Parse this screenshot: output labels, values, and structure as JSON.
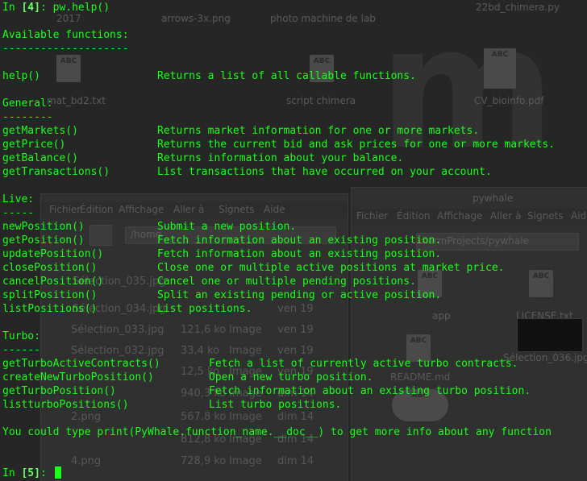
{
  "desktop": {
    "top_labels": [
      "2017",
      "arrows-3x.png",
      "photo machine de lab",
      "22bd_chimera.py"
    ],
    "mid_labels": [
      "mat_bd2.txt",
      "script chimera",
      "CV_bioinfo.pdf"
    ],
    "file_manager_left": {
      "menu": [
        "Fichier",
        "Édition",
        "Affichage",
        "Aller à",
        "Signets",
        "Aide"
      ],
      "path": "/home",
      "items": [
        {
          "name": "Sélection_035.jpg",
          "size": "",
          "type": "",
          "date": ""
        },
        {
          "name": "Sélection_034.jpg",
          "size": "",
          "type": "",
          "date": "ven 19"
        },
        {
          "name": "Sélection_033.jpg",
          "size": "121,6 ko",
          "type": "Image",
          "date": "ven 19"
        },
        {
          "name": "Sélection_032.jpg",
          "size": "33,4 ko",
          "type": "Image",
          "date": "ven 19"
        },
        {
          "name": "",
          "size": "12,5 ko",
          "type": "Image",
          "date": "ven 19"
        },
        {
          "name": "",
          "size": "940,3 ko",
          "type": "Image",
          "date": "dim 14"
        },
        {
          "name": "2.png",
          "size": "567,8 ko",
          "type": "Image",
          "date": "dim 14"
        },
        {
          "name": "",
          "size": "812,8 ko",
          "type": "Image",
          "date": "dim 14"
        },
        {
          "name": "4.png",
          "size": "728,9 ko",
          "type": "Image",
          "date": "dim 14"
        }
      ]
    },
    "file_manager_right": {
      "title": "pywhale",
      "menu": [
        "Fichier",
        "Édition",
        "Affichage",
        "Aller à",
        "Signets",
        "Aide"
      ],
      "path": "harmProjects/pywhale",
      "icons": [
        "app",
        "LICENSE.txt",
        "README.md",
        "Sélection_036.jpg"
      ]
    }
  },
  "terminal": {
    "prompt_in": "In",
    "prompt_num_1": "[4]",
    "command": "pw.help()",
    "header": "Available functions:",
    "rule_main": "--------------------",
    "help_fn": "help()",
    "help_desc": "Returns a list of all callable functions.",
    "sections": [
      {
        "title": "General:",
        "rule": "--------",
        "indent": 192,
        "items": [
          {
            "fn": "getMarkets()",
            "desc": "Returns market information for one or more markets."
          },
          {
            "fn": "getPrice()",
            "desc": "Returns the current bid and ask prices for one or more markets."
          },
          {
            "fn": "getBalance()",
            "desc": "Returns information about your balance."
          },
          {
            "fn": "getTransactions()",
            "desc": "List transactions that have occurred on your account."
          }
        ]
      },
      {
        "title": "Live:",
        "rule": "-----",
        "indent": 192,
        "items": [
          {
            "fn": "newPosition()",
            "desc": "Submit a new position."
          },
          {
            "fn": "getPosition()",
            "desc": "Fetch information about an existing position."
          },
          {
            "fn": "updatePosition()",
            "desc": "Fetch information about an existing position."
          },
          {
            "fn": "closePosition()",
            "desc": "Close one or multiple active positions at market price."
          },
          {
            "fn": "cancelPosition()",
            "desc": "Cancel one or multiple pending positions."
          },
          {
            "fn": "splitPosition()",
            "desc": "Split an existing pending or active position."
          },
          {
            "fn": "listPositions()",
            "desc": "List positions."
          }
        ]
      },
      {
        "title": "Turbo:",
        "rule": "------",
        "indent": 256,
        "items": [
          {
            "fn": "getTurboActiveContracts()",
            "desc": "Fetch a list of currently active turbo contracts."
          },
          {
            "fn": "createNewTurboPosition()",
            "desc": "Open a new turbo position."
          },
          {
            "fn": "getTurboPosition()",
            "desc": "Fetch information about an existing turbo position."
          },
          {
            "fn": "listturboPositions()",
            "desc": "List turbo positions."
          }
        ]
      }
    ],
    "footer": "You could type print(PyWhale.function_name.__doc__) to get more info about any function",
    "prompt_num_2": "[5]"
  }
}
